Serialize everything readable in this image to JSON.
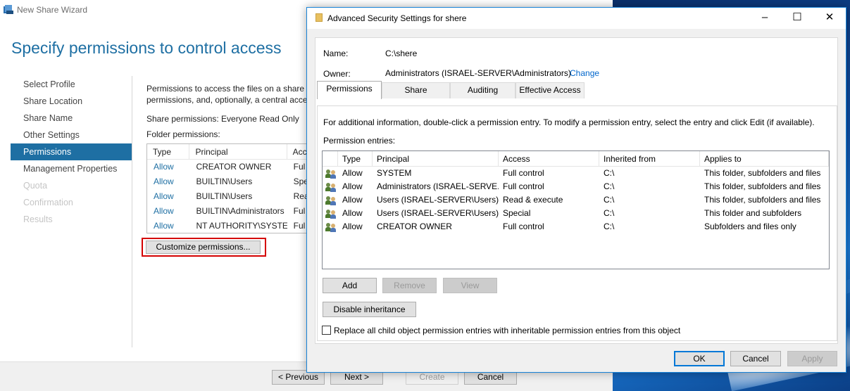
{
  "wizard": {
    "title": "New Share Wizard",
    "heading": "Specify permissions to control access",
    "nav": [
      {
        "label": "Select Profile",
        "state": "normal"
      },
      {
        "label": "Share Location",
        "state": "normal"
      },
      {
        "label": "Share Name",
        "state": "normal"
      },
      {
        "label": "Other Settings",
        "state": "normal"
      },
      {
        "label": "Permissions",
        "state": "selected"
      },
      {
        "label": "Management Properties",
        "state": "normal"
      },
      {
        "label": "Quota",
        "state": "disabled"
      },
      {
        "label": "Confirmation",
        "state": "disabled"
      },
      {
        "label": "Results",
        "state": "disabled"
      }
    ],
    "description_line1": "Permissions to access the files on a share a",
    "description_line2": "permissions, and, optionally, a central acces",
    "share_permissions": "Share permissions: Everyone Read Only",
    "folder_permissions_label": "Folder permissions:",
    "table": {
      "headers": [
        "Type",
        "Principal",
        "Acc"
      ],
      "rows": [
        [
          "Allow",
          "CREATOR OWNER",
          "Ful"
        ],
        [
          "Allow",
          "BUILTIN\\Users",
          "Spe"
        ],
        [
          "Allow",
          "BUILTIN\\Users",
          "Rea"
        ],
        [
          "Allow",
          "BUILTIN\\Administrators",
          "Ful"
        ],
        [
          "Allow",
          "NT AUTHORITY\\SYSTEM",
          "Ful"
        ]
      ]
    },
    "customize_button": "Customize permissions...",
    "footer": {
      "previous": "< Previous",
      "next": "Next >",
      "create": "Create",
      "cancel": "Cancel"
    }
  },
  "dialog": {
    "title": "Advanced Security Settings for shere",
    "name_label": "Name:",
    "name_value": "C:\\shere",
    "owner_label": "Owner:",
    "owner_value": "Administrators (ISRAEL-SERVER\\Administrators)",
    "change_link": "Change",
    "tabs": [
      "Permissions",
      "Share",
      "Auditing",
      "Effective Access"
    ],
    "info_text": "For additional information, double-click a permission entry. To modify a permission entry, select the entry and click Edit (if available).",
    "entries_label": "Permission entries:",
    "table": {
      "headers": [
        "Type",
        "Principal",
        "Access",
        "Inherited from",
        "Applies to"
      ],
      "rows": [
        [
          "Allow",
          "SYSTEM",
          "Full control",
          "C:\\",
          "This folder, subfolders and files"
        ],
        [
          "Allow",
          "Administrators (ISRAEL-SERVE...",
          "Full control",
          "C:\\",
          "This folder, subfolders and files"
        ],
        [
          "Allow",
          "Users (ISRAEL-SERVER\\Users)",
          "Read & execute",
          "C:\\",
          "This folder, subfolders and files"
        ],
        [
          "Allow",
          "Users (ISRAEL-SERVER\\Users)",
          "Special",
          "C:\\",
          "This folder and subfolders"
        ],
        [
          "Allow",
          "CREATOR OWNER",
          "Full control",
          "C:\\",
          "Subfolders and files only"
        ]
      ]
    },
    "buttons": {
      "add": "Add",
      "remove": "Remove",
      "view": "View",
      "disable_inheritance": "Disable inheritance",
      "ok": "OK",
      "cancel": "Cancel",
      "apply": "Apply"
    },
    "replace_checkbox_label": "Replace all child object permission entries with inheritable permission entries from this object",
    "replace_checked": false
  },
  "colors": {
    "accent": "#1e6fa3",
    "link": "#0066cc",
    "highlight_border": "#d40000"
  }
}
